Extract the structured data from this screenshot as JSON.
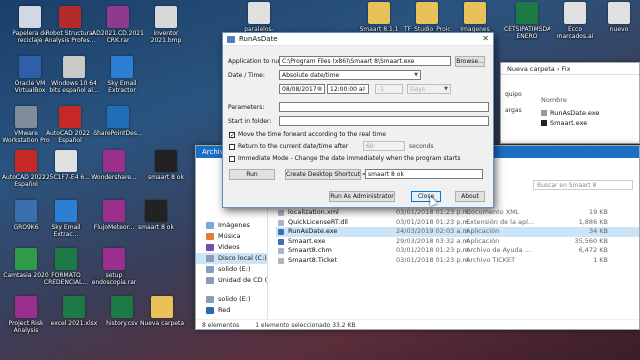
{
  "desktop": {
    "icons": [
      {
        "label": "Papelera de reciclaje",
        "icon": "recycle-bin-icon",
        "color": "#cfd8e3"
      },
      {
        "label": "Robot Structural Analysis Profes...",
        "icon": "app-icon",
        "color": "#b32b2b"
      },
      {
        "label": "AD2021.CD.2021 CRK.rar",
        "icon": "archive-icon",
        "color": "#8e3b8e"
      },
      {
        "label": "inventor 2021.bmp",
        "icon": "image-icon",
        "color": "#d8d8d8"
      },
      {
        "label": "Oracle VM VirtualBox",
        "icon": "virtualbox-icon",
        "color": "#2e5fa8"
      },
      {
        "label": "Windows 10 64 bits español al...",
        "icon": "disc-icon",
        "color": "#c9c9c9"
      },
      {
        "label": "Sky Email Extractor",
        "icon": "email-icon",
        "color": "#2d7fd3"
      },
      {
        "label": "VMware Workstation Pro",
        "icon": "vmware-icon",
        "color": "#7f8c99"
      },
      {
        "label": "AutoCAD 2022 - Español",
        "icon": "autocad-icon",
        "color": "#c62828"
      },
      {
        "label": "SharePointDes...",
        "icon": "sharepoint-icon",
        "color": "#1e6fb8"
      },
      {
        "label": "AutoCAD 2021 - Español",
        "icon": "autocad-icon",
        "color": "#c62828"
      },
      {
        "label": "225C1F7-E4 6...",
        "icon": "file-icon",
        "color": "#e0e0e0"
      },
      {
        "label": "Wondershare...",
        "icon": "archive-icon",
        "color": "#9b2f8e"
      },
      {
        "label": "smaart 8 ok",
        "icon": "app-icon",
        "color": "#222222"
      },
      {
        "label": "GRO9K6",
        "icon": "app-icon",
        "color": "#3a6fb0"
      },
      {
        "label": "Sky Email Extrac...",
        "icon": "email-icon",
        "color": "#2d7fd3"
      },
      {
        "label": "FlujoMeteor...",
        "icon": "archive-icon",
        "color": "#9b2f8e"
      },
      {
        "label": "smaart 8 ok",
        "icon": "app-icon",
        "color": "#222222"
      },
      {
        "label": "Camtasia 2020",
        "icon": "camtasia-icon",
        "color": "#2f9b48"
      },
      {
        "label": "FORMATO CREDENCIAL...",
        "icon": "excel-icon",
        "color": "#1d7a44"
      },
      {
        "label": "setup endoscopia.rar",
        "icon": "archive-icon",
        "color": "#9b2f8e"
      },
      {
        "label": "Project Risk Analysis",
        "icon": "archive-icon",
        "color": "#9b2f8e"
      },
      {
        "label": "excel 2021.xlsx",
        "icon": "excel-icon",
        "color": "#1d7a44"
      },
      {
        "label": "history.csv",
        "icon": "excel-icon",
        "color": "#1d7a44"
      },
      {
        "label": "Nueva carpeta",
        "icon": "folder-icon",
        "color": "#e8c15a"
      }
    ],
    "top_right_icons": [
      {
        "label": "paralelos-red.txt",
        "icon": "text-file-icon",
        "color": "#e0e0e0"
      },
      {
        "label": "Smaart 8.1.1 Software",
        "icon": "folder-icon",
        "color": "#e8c15a"
      },
      {
        "label": "TF_Studio_Proid...",
        "icon": "folder-icon",
        "color": "#e8c15a"
      },
      {
        "label": "Imagenes",
        "icon": "folder-icon",
        "color": "#e8c15a"
      },
      {
        "label": "CETSIPATIMSDA ENERO 2019.xlsx",
        "icon": "excel-icon",
        "color": "#1d7a44"
      },
      {
        "label": "Ecco marcados.ai",
        "icon": "file-icon",
        "color": "#e0e0e0"
      },
      {
        "label": "nuevo",
        "icon": "file-icon",
        "color": "#e0e0e0"
      }
    ]
  },
  "explorer_right": {
    "breadcrumb": "Nueva carpeta  ›  Fix",
    "column_header": "Nombre",
    "files": [
      "RunAsDate.exe",
      "Smaart.exe"
    ],
    "side_labels": [
      "quipo",
      "argas"
    ]
  },
  "explorer_main": {
    "ribbon": "Archivo",
    "search_placeholder": "Buscar en Smaart 8",
    "nav_items": [
      {
        "label": "Imágenes",
        "color": "#7aa7d8"
      },
      {
        "label": "Música",
        "color": "#e07b39"
      },
      {
        "label": "Videos",
        "color": "#6f4fb2"
      },
      {
        "label": "Disco local (C:)",
        "color": "#8a9ab8",
        "selected": true
      },
      {
        "label": "solido (E:)",
        "color": "#8a9ab8"
      },
      {
        "label": "Unidad de CD (F",
        "color": "#8a9ab8"
      },
      {
        "label": "solido (E:)",
        "color": "#8a9ab8"
      },
      {
        "label": "Red",
        "color": "#2b6cb0"
      }
    ],
    "files": [
      {
        "name": "localization.xml",
        "date": "03/01/2018 01:23 p.m.",
        "type": "Documento XML",
        "size": "19 KB"
      },
      {
        "name": "QuickLicenseRT.dll",
        "date": "03/01/2018 01:23 p.m.",
        "type": "Extensión de la apl...",
        "size": "1,886 KB"
      },
      {
        "name": "RunAsDate.exe",
        "date": "24/03/2019 02:03 a.m.",
        "type": "Aplicación",
        "size": "34 KB",
        "selected": true
      },
      {
        "name": "Smaart.exe",
        "date": "29/03/2018 03:32 a.m.",
        "type": "Aplicación",
        "size": "35,560 KB"
      },
      {
        "name": "Smaart8.chm",
        "date": "03/01/2018 01:23 p.m.",
        "type": "Archivo de Ayuda ...",
        "size": "6,472 KB"
      },
      {
        "name": "Smaart8.Ticket",
        "date": "03/01/2018 01:23 p.m.",
        "type": "Archivo TICKET",
        "size": "1 KB"
      }
    ],
    "status": {
      "count": "8 elementos",
      "selected": "1 elemento seleccionado  33.2 KB"
    }
  },
  "dialog": {
    "title": "RunAsDate",
    "close_glyph": "✕",
    "app_label": "Application to run:",
    "app_value": "C:\\Program Files (x86)\\Smaart 8\\Smaart.exe",
    "browse_label": "Browse...",
    "date_label": "Date / Time:",
    "date_mode": "Absolute date/time",
    "date_value": "08/08/2017",
    "time_value": "12:00:00 a.",
    "offset_value": "-1",
    "offset_unit": "Days",
    "params_label": "Parameters:",
    "params_value": "",
    "startin_label": "Start in folder:",
    "startin_value": "",
    "opt_move": "Move the time forward according to the real time",
    "opt_move_checked": true,
    "opt_return": "Return to the current date/time after",
    "opt_return_checked": false,
    "seconds_value": "60",
    "seconds_label": "seconds",
    "opt_immediate": "Immediate Mode - Change the date immediately when the program starts",
    "opt_immediate_checked": false,
    "run_label": "Run",
    "shortcut_label": "Create Desktop Shortcut =>",
    "shortcut_name": "smaart 8 ok",
    "admin_label": "Run As Administrator",
    "close_label": "Close",
    "about_label": "About"
  }
}
